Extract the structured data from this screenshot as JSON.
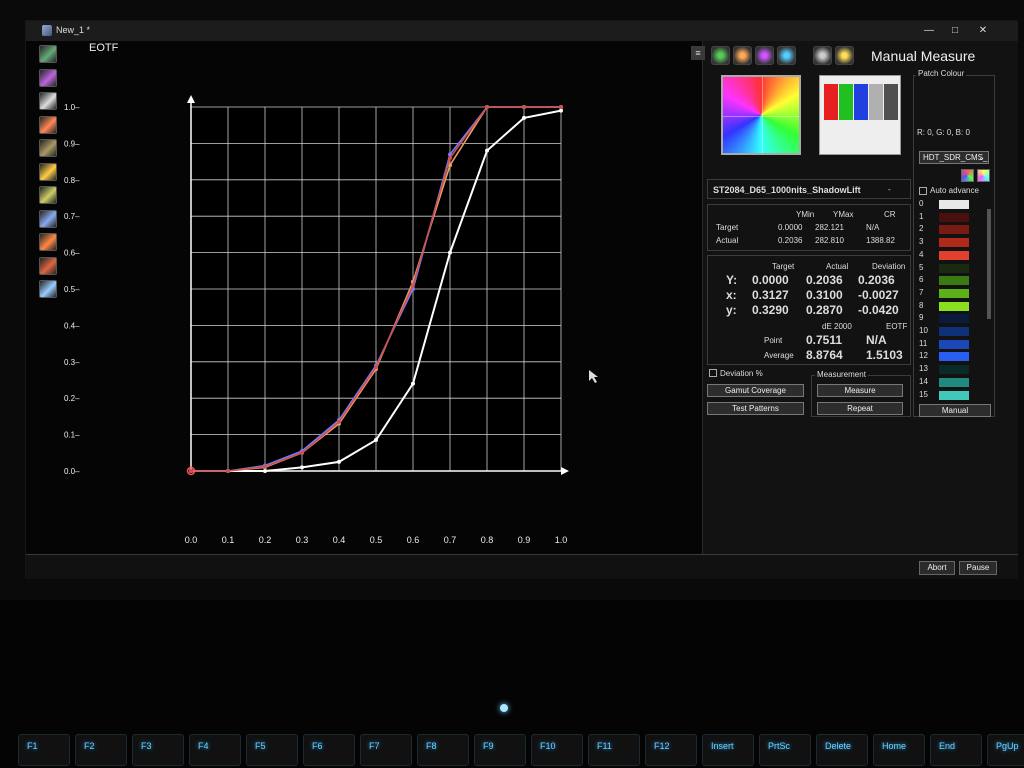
{
  "window": {
    "title": "New_1 *"
  },
  "toolbar": {
    "icons": [
      "gamut-tool-icon",
      "gamut-xy-icon",
      "gamut-uv-icon",
      "eotf-icon",
      "rgb-balance-icon",
      "gamma-icon",
      "luminance-icon",
      "dE-icon",
      "cct-icon",
      "colorchecker-icon",
      "spectrum-icon"
    ]
  },
  "chart": {
    "label": "EOTF",
    "chart_data": {
      "type": "line",
      "x_ticks": [
        "0.0",
        "0.1",
        "0.2",
        "0.3",
        "0.4",
        "0.5",
        "0.6",
        "0.7",
        "0.8",
        "0.9",
        "1.0"
      ],
      "y_ticks": [
        "1.0",
        "0.9",
        "0.8",
        "0.7",
        "0.6",
        "0.5",
        "0.4",
        "0.3",
        "0.2",
        "0.1",
        "0.0"
      ],
      "xlim": [
        0,
        1
      ],
      "ylim": [
        0,
        1
      ],
      "grid": true,
      "series": [
        {
          "color": "#ffffff",
          "x": [
            0,
            0.1,
            0.2,
            0.3,
            0.4,
            0.5,
            0.6,
            0.7,
            0.8,
            0.9,
            1.0
          ],
          "y": [
            0,
            0,
            0,
            0.01,
            0.025,
            0.085,
            0.24,
            0.6,
            0.88,
            0.97,
            0.99
          ]
        },
        {
          "color": "#e8a060",
          "x": [
            0,
            0.1,
            0.2,
            0.3,
            0.4,
            0.5,
            0.6,
            0.7,
            0.8,
            0.9,
            1.0
          ],
          "y": [
            0,
            0,
            0.01,
            0.05,
            0.13,
            0.28,
            0.52,
            0.84,
            1.0,
            1.0,
            1.0
          ]
        },
        {
          "color": "#6f7cff",
          "x": [
            0,
            0.1,
            0.2,
            0.3,
            0.4,
            0.5,
            0.6,
            0.7,
            0.8,
            0.9,
            1.0
          ],
          "y": [
            0,
            0,
            0.015,
            0.055,
            0.14,
            0.29,
            0.5,
            0.87,
            1.0,
            1.0,
            1.0
          ]
        },
        {
          "color": "#d05050",
          "x": [
            0,
            0.1,
            0.2,
            0.3,
            0.4,
            0.5,
            0.6,
            0.7,
            0.8,
            0.9,
            1.0
          ],
          "y": [
            0,
            0,
            0.012,
            0.05,
            0.135,
            0.285,
            0.51,
            0.86,
            1.0,
            1.0,
            1.0
          ]
        }
      ]
    }
  },
  "panel": {
    "title": "Manual Measure",
    "tool_icons": [
      "gamut-icon",
      "colorwheel-icon",
      "saturation-icon",
      "grayscale-icon",
      "eotf-preview-icon",
      "contrast-icon"
    ],
    "patch_thumb": {
      "bars": [
        "#e62020",
        "#20c020",
        "#2040e0",
        "#b0b0b0",
        "#505050"
      ]
    },
    "patch_colour": {
      "label": "Patch Colour",
      "rgb_text": "R: 0, G: 0, B: 0",
      "preset": "HDT_SDR_CMS_",
      "auto_advance": "Auto advance",
      "manual_button": "Manual"
    },
    "target_name": {
      "text": "ST2084_D65_1000nits_ShadowLift",
      "suffix": "-"
    },
    "yminmax": {
      "headers": [
        "YMin",
        "YMax",
        "CR"
      ],
      "rows": [
        {
          "label": "Target",
          "values": [
            "0.0000",
            "282.121",
            "N/A"
          ]
        },
        {
          "label": "Actual",
          "values": [
            "0.2036",
            "282.810",
            "1388.82"
          ]
        }
      ]
    },
    "readings": {
      "headers": [
        "Target",
        "Actual",
        "Deviation"
      ],
      "rows": [
        {
          "label": "Y:",
          "values": [
            "0.0000",
            "0.2036",
            "0.2036"
          ]
        },
        {
          "label": "x:",
          "values": [
            "0.3127",
            "0.3100",
            "-0.0027"
          ]
        },
        {
          "label": "y:",
          "values": [
            "0.3290",
            "0.2870",
            "-0.0420"
          ]
        }
      ],
      "de_header": "dE 2000",
      "eotf_header": "EOTF",
      "point_label": "Point",
      "point_de": "0.7511",
      "point_eotf": "N/A",
      "avg_label": "Average",
      "avg_de": "8.8764",
      "avg_eotf": "1.5103"
    },
    "deviation_pct": "Deviation %",
    "gamut_btn": "Gamut Coverage",
    "test_patterns_btn": "Test Patterns",
    "measurement": {
      "label": "Measurement",
      "measure_btn": "Measure",
      "repeat_btn": "Repeat"
    },
    "patches": [
      {
        "num": "0",
        "color": "#e8e8e8"
      },
      {
        "num": "1",
        "color": "#4a1010"
      },
      {
        "num": "2",
        "color": "#7a1a14"
      },
      {
        "num": "3",
        "color": "#b02a1c"
      },
      {
        "num": "4",
        "color": "#e0402c"
      },
      {
        "num": "5",
        "color": "#1a2a10"
      },
      {
        "num": "6",
        "color": "#3a7a14"
      },
      {
        "num": "7",
        "color": "#5cb018"
      },
      {
        "num": "8",
        "color": "#8ae020"
      },
      {
        "num": "9",
        "color": "#0a1a3a"
      },
      {
        "num": "10",
        "color": "#10307a"
      },
      {
        "num": "11",
        "color": "#1a48b8"
      },
      {
        "num": "12",
        "color": "#2a5ef0"
      },
      {
        "num": "13",
        "color": "#0a2a2a"
      },
      {
        "num": "14",
        "color": "#208a80"
      },
      {
        "num": "15",
        "color": "#40c8b8"
      }
    ]
  },
  "status": {
    "abort": "Abort",
    "pause": "Pause"
  },
  "keyboard": {
    "keys": [
      "F1",
      "F2",
      "F3",
      "F4",
      "F5",
      "F6",
      "F7",
      "F8",
      "F9",
      "F10",
      "F11",
      "F12",
      "Insert",
      "PrtSc",
      "Delete",
      "Home",
      "End",
      "PgUp"
    ]
  }
}
